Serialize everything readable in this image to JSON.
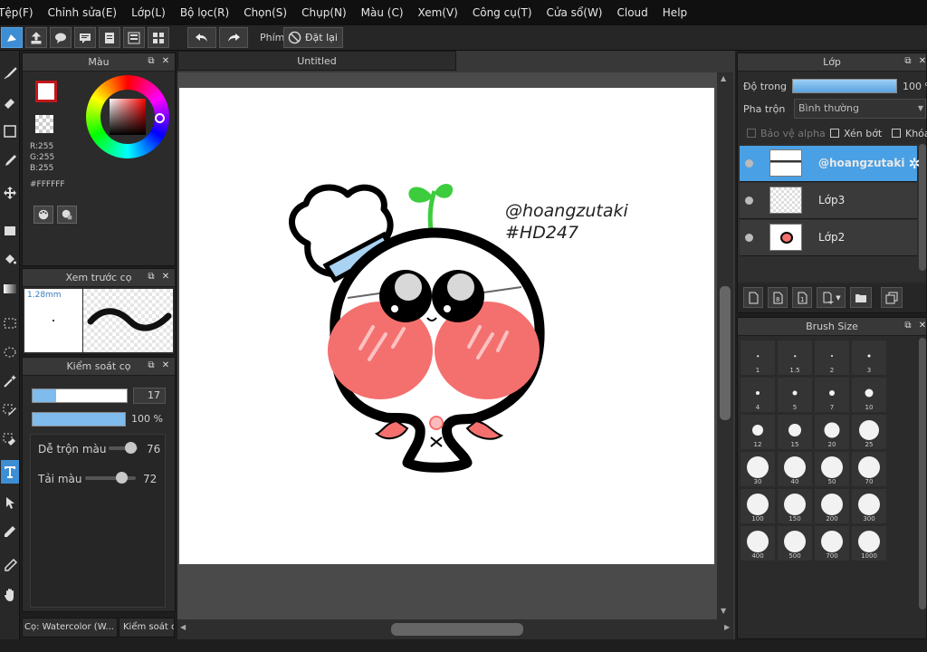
{
  "menu": [
    "Tệp(F)",
    "Chỉnh sửa(E)",
    "Lớp(L)",
    "Bộ lọc(R)",
    "Chọn(S)",
    "Chụp(N)",
    "Màu (C)",
    "Xem(V)",
    "Công cụ(T)",
    "Cửa sổ(W)",
    "Cloud",
    "Help"
  ],
  "toolbar": {
    "snap_label": "Phím",
    "reset_label": "Đặt lại"
  },
  "color_panel": {
    "title": "Màu",
    "r": "R:255",
    "g": "G:255",
    "b": "B:255",
    "hex": "#FFFFFF"
  },
  "preview_panel": {
    "title": "Xem trước cọ",
    "size": "1.28mm"
  },
  "brush_control": {
    "title": "Kiểm soát cọ",
    "size_value": "17",
    "opacity_value": "100 %",
    "mix_label": "Dễ trộn màu",
    "mix_value": "76",
    "load_label": "Tải màu",
    "load_value": "72",
    "size_level": 0.25,
    "opacity_level": 1.0,
    "mix_level": 0.76,
    "load_level": 0.72
  },
  "bottom_tabs": [
    "Cọ: Watercolor (W...",
    "Kiểm soát c"
  ],
  "document": {
    "tab_title": "Untitled"
  },
  "artwork": {
    "line1": "@hoangzutaki",
    "line2": "#HD247"
  },
  "layer_panel": {
    "title": "Lớp",
    "opacity_label": "Độ trong",
    "opacity_value": "100 %",
    "opacity_level": 1.0,
    "blend_label": "Pha trộn",
    "blend_value": "Bình thường",
    "protect_alpha": "Bảo vệ alpha",
    "clipping": "Xén bớt",
    "lock": "Khóa",
    "layers": [
      {
        "name": "@hoangzutaki",
        "selected": true
      },
      {
        "name": "Lớp3",
        "selected": false
      },
      {
        "name": "Lớp2",
        "selected": false
      }
    ]
  },
  "brush_size_panel": {
    "title": "Brush Size",
    "sizes": [
      "1",
      "1.5",
      "2",
      "3",
      "4",
      "5",
      "7",
      "10",
      "12",
      "15",
      "20",
      "25",
      "30",
      "40",
      "50",
      "70",
      "100",
      "150",
      "200",
      "300",
      "400",
      "500",
      "700",
      "1000"
    ]
  },
  "colors": {
    "accent": "#3d8ed4",
    "canvas": "#ffffff",
    "blush": "#f4706e"
  }
}
